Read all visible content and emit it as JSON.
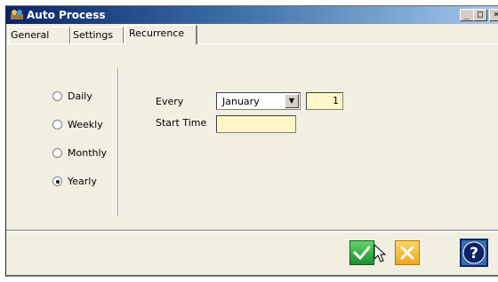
{
  "window": {
    "title": "Auto Process",
    "controls": {
      "minimize": "_",
      "maximize": "□",
      "close": "×"
    }
  },
  "tabs": [
    {
      "label": "General",
      "active": false
    },
    {
      "label": "Settings",
      "active": false
    },
    {
      "label": "Recurrence",
      "active": true
    }
  ],
  "recurrence": {
    "options": [
      {
        "label": "Daily",
        "selected": false
      },
      {
        "label": "Weekly",
        "selected": false
      },
      {
        "label": "Monthly",
        "selected": false
      },
      {
        "label": "Yearly",
        "selected": true
      }
    ],
    "every_label": "Every",
    "month_value": "January",
    "interval_value": "1",
    "start_time_label": "Start Time",
    "start_time_value": ""
  },
  "footer": {
    "ok_icon": "check-icon",
    "cancel_icon": "x-icon",
    "help_icon": "question-icon"
  },
  "colors": {
    "input_background": "#fff8c6",
    "ok_green": "#1e8f2d",
    "cancel_yellow": "#f0a81c",
    "help_blue": "#3a6ea5"
  }
}
